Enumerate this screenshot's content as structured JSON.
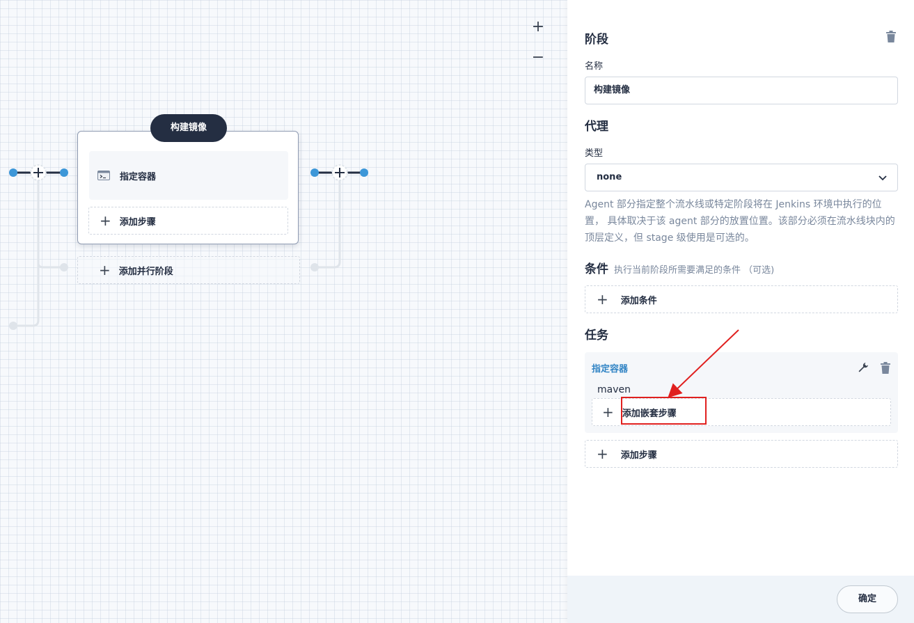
{
  "canvas": {
    "zoom_in": "+",
    "zoom_out": "−",
    "stage": {
      "title": "构建镜像",
      "step_label": "指定容器",
      "add_step_label": "添加步骤"
    },
    "add_parallel_label": "添加并行阶段"
  },
  "panel": {
    "stage_section": "阶段",
    "name_label": "名称",
    "name_value": "构建镜像",
    "agent_section": "代理",
    "type_label": "类型",
    "type_value": "none",
    "agent_description": "Agent 部分指定整个流水线或特定阶段将在 Jenkins 环境中执行的位置， 具体取决于该 agent 部分的放置位置。该部分必须在流水线块内的顶层定义，但 stage 级使用是可选的。",
    "conditions_section": "条件",
    "conditions_subtitle": "执行当前阶段所需要满足的条件 （可选)",
    "add_condition_label": "添加条件",
    "tasks_section": "任务",
    "task": {
      "name": "指定容器",
      "value": "maven",
      "add_nested_label": "添加嵌套步骤"
    },
    "add_step_label": "添加步骤",
    "confirm_label": "确定"
  },
  "colors": {
    "dark": "#242e42",
    "node_blue": "#3d97d8",
    "annotation_red": "#e0201f",
    "task_link": "#3385c5"
  }
}
